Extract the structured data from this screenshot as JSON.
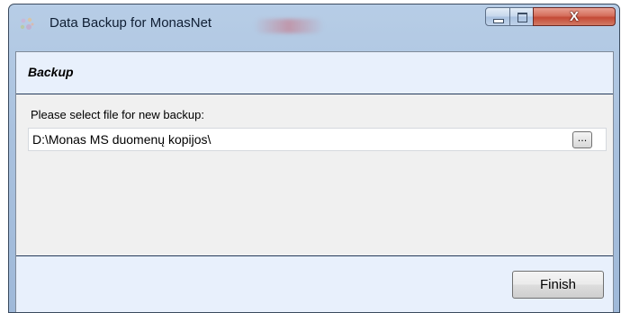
{
  "window": {
    "title": "Data Backup for MonasNet",
    "icon": "app-icon"
  },
  "caption_buttons": {
    "minimize_icon": "minimize-icon",
    "maximize_icon": "maximize-icon",
    "close_glyph": "X"
  },
  "header": {
    "title": "Backup"
  },
  "form": {
    "prompt": "Please select file for new backup:",
    "path_value": "D:\\Monas MS duomenų kopijos\\",
    "browse_label": "..."
  },
  "footer": {
    "finish_label": "Finish"
  },
  "colors": {
    "frame": "#a9c1de",
    "header_band": "#e8f0fc",
    "close_button": "#c44a36"
  }
}
